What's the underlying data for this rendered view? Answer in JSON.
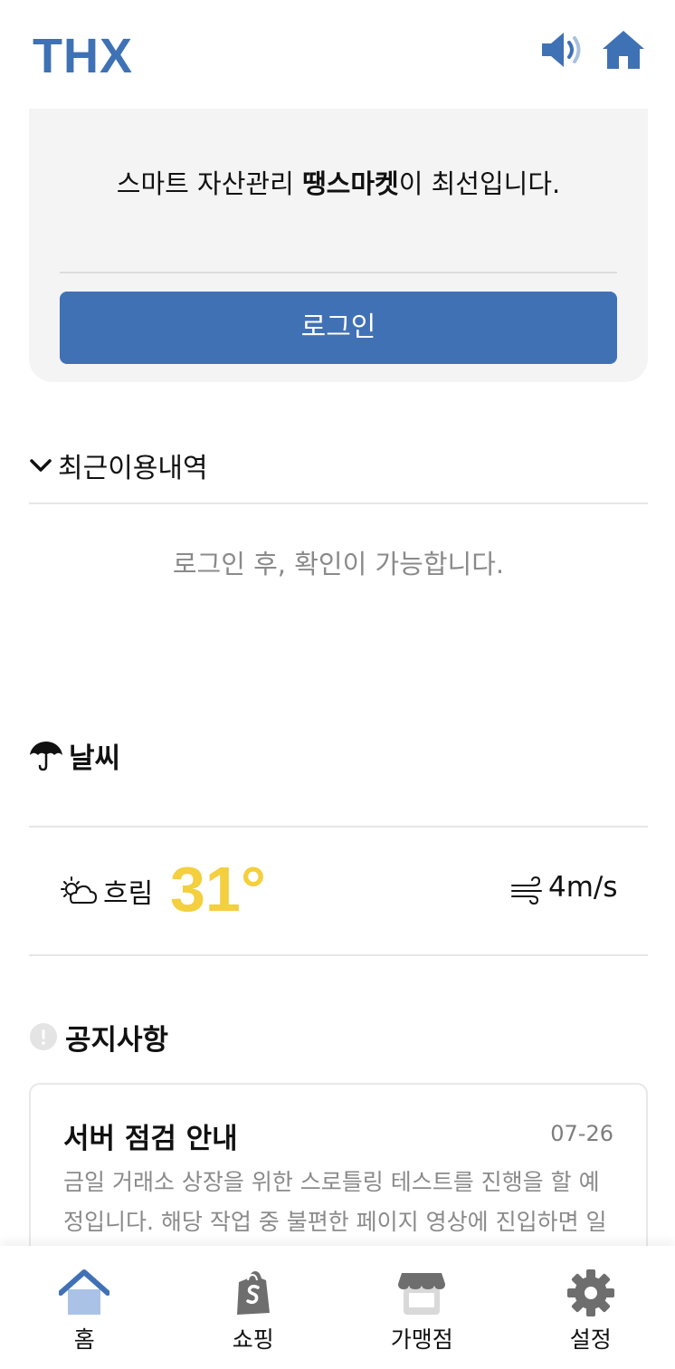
{
  "header": {
    "logo": "THX",
    "speaker_icon": "speaker-icon",
    "home_icon": "home-icon"
  },
  "login_card": {
    "slogan_prefix": "스마트 자산관리 ",
    "slogan_brand": "땡스마켓",
    "slogan_suffix": "이 최선입니다.",
    "login_button": "로그인"
  },
  "recent": {
    "title": "최근이용내역",
    "message": "로그인 후, 확인이 가능합니다."
  },
  "weather": {
    "title": "날씨",
    "condition": "흐림",
    "temperature": "31°",
    "wind": "4m/s",
    "temp_color": "#f4cf3e"
  },
  "notice": {
    "title": "공지사항",
    "item": {
      "title": "서버 점검 안내",
      "date": "07-26",
      "body": "금일 거래소 상장을 위한 스로틀링 테스트를 진행을 할 예정입니다. 해당 작업 중 불편한 페이지 영상에 진입하면 일부를 해야"
    }
  },
  "nav": {
    "items": [
      {
        "label": "홈",
        "icon": "home-icon"
      },
      {
        "label": "쇼핑",
        "icon": "shopping-bag-icon"
      },
      {
        "label": "가맹점",
        "icon": "store-icon"
      },
      {
        "label": "설정",
        "icon": "gear-icon"
      }
    ],
    "active_color": "#4171b5"
  },
  "colors": {
    "brand": "#3f71b5",
    "card_bg": "#f4f4f4",
    "button": "#4171b5"
  }
}
